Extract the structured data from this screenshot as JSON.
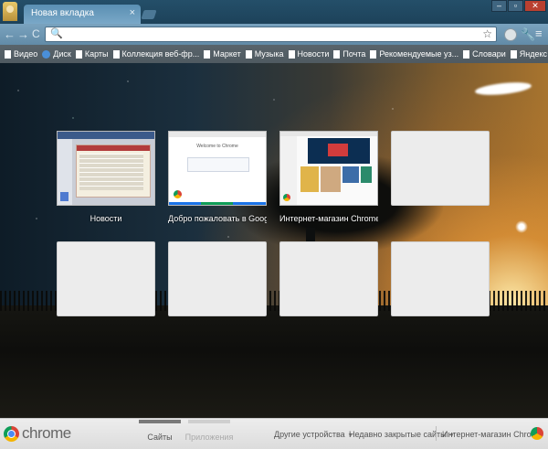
{
  "window": {
    "tab_title": "Новая вкладка",
    "tab_close": "×",
    "controls": {
      "minimize": "–",
      "maximize": "▫",
      "close": "✕"
    }
  },
  "toolbar": {
    "back": "←",
    "forward": "→",
    "reload": "C",
    "search_glyph": "🔍",
    "url_value": "",
    "bookmark_star": "☆",
    "wrench": "🔧",
    "menu": "≡"
  },
  "bookmarks": [
    {
      "label": "Видео",
      "icon": "page-icon"
    },
    {
      "label": "Диск",
      "icon": "globe-icon"
    },
    {
      "label": "Карты",
      "icon": "page-icon"
    },
    {
      "label": "Коллекция веб-фр...",
      "icon": "page-icon"
    },
    {
      "label": "Маркет",
      "icon": "page-icon"
    },
    {
      "label": "Музыка",
      "icon": "page-icon"
    },
    {
      "label": "Новости",
      "icon": "page-icon"
    },
    {
      "label": "Почта",
      "icon": "page-icon"
    },
    {
      "label": "Рекомендуемые уз...",
      "icon": "page-icon"
    },
    {
      "label": "Словари",
      "icon": "page-icon"
    },
    {
      "label": "Яндекс",
      "icon": "page-icon"
    }
  ],
  "tiles": {
    "row1": [
      {
        "title": "Новости",
        "thumbnail": "news-page"
      },
      {
        "title": "Добро пожаловать в Googl...",
        "thumbnail": "welcome-page",
        "thumb_heading": "Welcome to Chrome"
      },
      {
        "title": "Интернет-магазин Chrome",
        "thumbnail": "store-page"
      },
      {
        "title": "",
        "thumbnail": "empty"
      }
    ],
    "row2": [
      {
        "title": "",
        "thumbnail": "empty"
      },
      {
        "title": "",
        "thumbnail": "empty"
      },
      {
        "title": "",
        "thumbnail": "empty"
      },
      {
        "title": "",
        "thumbnail": "empty"
      }
    ]
  },
  "footer": {
    "brand": "chrome",
    "pages": [
      {
        "label": "Сайты",
        "active": true
      },
      {
        "label": "Приложения",
        "active": false
      }
    ],
    "other_devices": "Другие устройства",
    "recently_closed": "Недавно закрытые сайты",
    "web_store": "Интернет-магазин Chrome",
    "caret": "▼"
  },
  "colors": {
    "titlebar": "#1d425a",
    "tab": "#6a9cbd",
    "bookmarks_bar": "#545f66",
    "footer": "#e4e4e4"
  }
}
